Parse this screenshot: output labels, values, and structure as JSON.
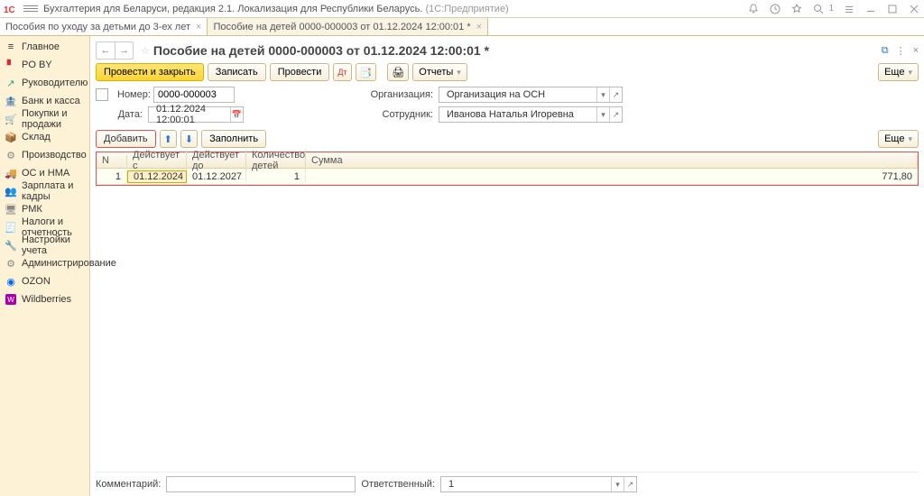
{
  "app": {
    "title_main": "Бухгалтерия для Беларуси, редакция 2.1. Локализация для Республики Беларусь.",
    "title_gray": "(1С:Предприятие)"
  },
  "titlebar_right": {
    "search_num": "1"
  },
  "tabs": [
    {
      "label": "Пособия по уходу за детьми до 3-ех лет",
      "active": false
    },
    {
      "label": "Пособие на детей 0000-000003 от 01.12.2024 12:00:01 *",
      "active": true
    }
  ],
  "sidebar": [
    {
      "label": "Главное"
    },
    {
      "label": "PO BY"
    },
    {
      "label": "Руководителю"
    },
    {
      "label": "Банк и касса"
    },
    {
      "label": "Покупки и продажи"
    },
    {
      "label": "Склад"
    },
    {
      "label": "Производство"
    },
    {
      "label": "ОС и НМА"
    },
    {
      "label": "Зарплата и кадры"
    },
    {
      "label": "РМК"
    },
    {
      "label": "Налоги и отчетность"
    },
    {
      "label": "Настройки учета"
    },
    {
      "label": "Администрирование"
    },
    {
      "label": "OZON"
    },
    {
      "label": "Wildberries"
    }
  ],
  "page": {
    "title": "Пособие на детей 0000-000003 от 01.12.2024 12:00:01 *"
  },
  "toolbar": {
    "post_close": "Провести и закрыть",
    "write": "Записать",
    "post": "Провести",
    "reports": "Отчеты",
    "more": "Еще"
  },
  "form": {
    "number_lbl": "Номер:",
    "number_val": "0000-000003",
    "date_lbl": "Дата:",
    "date_val": "01.12.2024 12:00:01",
    "org_lbl": "Организация:",
    "org_val": "Организация на ОСН",
    "emp_lbl": "Сотрудник:",
    "emp_val": "Иванова Наталья Игоревна"
  },
  "sub": {
    "add": "Добавить",
    "fill": "Заполнить",
    "more": "Еще"
  },
  "table": {
    "headers": {
      "n": "N",
      "from": "Действует с",
      "to": "Действует до",
      "cnt": "Количество детей",
      "sum": "Сумма"
    },
    "rows": [
      {
        "n": "1",
        "from": "01.12.2024",
        "to": "01.12.2027",
        "cnt": "1",
        "sum": "771,80"
      }
    ]
  },
  "footer": {
    "comment_lbl": "Комментарий:",
    "resp_lbl": "Ответственный:",
    "resp_val": "1"
  }
}
